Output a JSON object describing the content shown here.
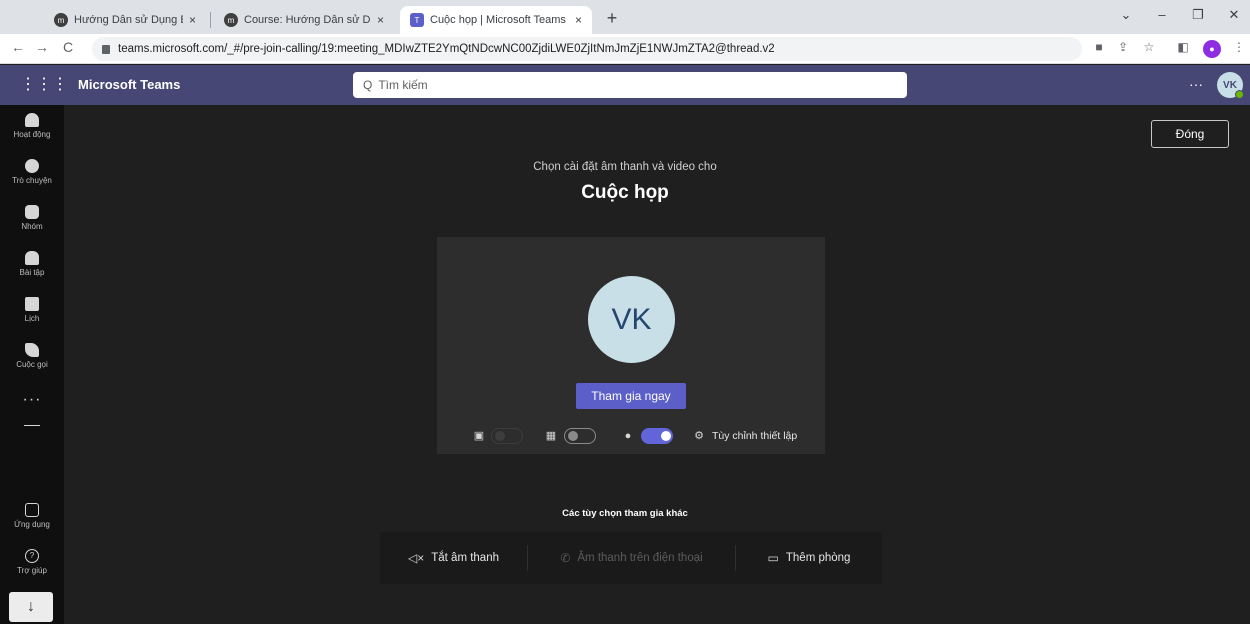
{
  "browser": {
    "tabs": [
      {
        "title": "Hướng Dẫn sử Dụng E-Learning",
        "favicon": "moodle-icon"
      },
      {
        "title": "Course: Hướng Dẫn sử Dụng E-L",
        "favicon": "moodle-icon"
      },
      {
        "title": "Cuộc họp | Microsoft Teams",
        "favicon": "teams-icon"
      }
    ],
    "tab_close": "×",
    "new_tab": "+",
    "url": "teams.microsoft.com/_#/pre-join-calling/19:meeting_MDIwZTE2YmQtNDcwNC00ZjdiLWE0ZjItNmJmZjE1NWJmZTA2@thread.v2"
  },
  "teams": {
    "app_name": "Microsoft Teams",
    "search_placeholder": "Tìm kiếm",
    "more": "···",
    "user_initials": "VK",
    "accent": "#5b5fc7",
    "header_color": "#464775"
  },
  "rail": {
    "items": [
      {
        "label": "Hoạt động",
        "icon": "bell-icon"
      },
      {
        "label": "Trò chuyện",
        "icon": "chat-icon"
      },
      {
        "label": "Nhóm",
        "icon": "teams-group-icon"
      },
      {
        "label": "Bài tập",
        "icon": "assignments-icon"
      },
      {
        "label": "Lịch",
        "icon": "calendar-icon"
      },
      {
        "label": "Cuộc gọi",
        "icon": "phone-icon"
      }
    ],
    "more": "···",
    "apps_label": "Ứng dụng",
    "help_label": "Trợ giúp",
    "download": "↓"
  },
  "prejoin": {
    "close_label": "Đóng",
    "subtitle": "Chọn cài đặt âm thanh và video cho",
    "meeting_title": "Cuộc họp",
    "avatar_initials": "VK",
    "join_label": "Tham gia ngay",
    "camera_on": false,
    "blur_on": false,
    "mic_on": true,
    "settings_label": "Tùy chỉnh thiết lập"
  },
  "other_options": {
    "title": "Các tùy chọn tham gia khác",
    "items": [
      {
        "label": "Tắt âm thanh",
        "icon": "speaker-mute-icon",
        "enabled": true
      },
      {
        "label": "Âm thanh trên điện thoại",
        "icon": "phone-icon",
        "enabled": false
      },
      {
        "label": "Thêm phòng",
        "icon": "cast-room-icon",
        "enabled": true
      }
    ]
  }
}
